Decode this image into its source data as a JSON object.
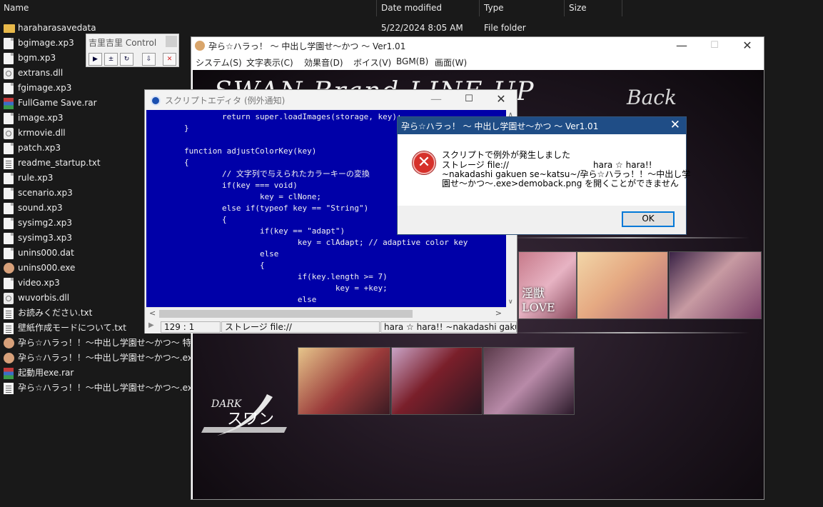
{
  "explorer": {
    "columns": {
      "name": "Name",
      "date": "Date modified",
      "type": "Type",
      "size": "Size"
    },
    "rows": [
      {
        "name": "haraharasavedata",
        "date": "5/22/2024 8:05 AM",
        "type": "File folder",
        "icon": "folder-icon"
      },
      {
        "name": "bgimage.xp3",
        "icon": "file-icon"
      },
      {
        "name": "bgm.xp3",
        "icon": "file-icon"
      },
      {
        "name": "extrans.dll",
        "icon": "dll-icon"
      },
      {
        "name": "fgimage.xp3",
        "icon": "file-icon"
      },
      {
        "name": "FullGame Save.rar",
        "icon": "rar-icon"
      },
      {
        "name": "image.xp3",
        "icon": "file-icon"
      },
      {
        "name": "krmovie.dll",
        "icon": "dll-icon"
      },
      {
        "name": "patch.xp3",
        "icon": "file-icon"
      },
      {
        "name": "readme_startup.txt",
        "icon": "text-file-icon"
      },
      {
        "name": "rule.xp3",
        "icon": "file-icon"
      },
      {
        "name": "scenario.xp3",
        "icon": "file-icon"
      },
      {
        "name": "sound.xp3",
        "icon": "file-icon"
      },
      {
        "name": "sysimg2.xp3",
        "icon": "file-icon"
      },
      {
        "name": "sysimg3.xp3",
        "icon": "file-icon"
      },
      {
        "name": "unins000.dat",
        "icon": "file-icon"
      },
      {
        "name": "unins000.exe",
        "icon": "exe-icon"
      },
      {
        "name": "video.xp3",
        "icon": "file-icon"
      },
      {
        "name": "wuvorbis.dll",
        "icon": "dll-icon"
      },
      {
        "name": "お読みください.txt",
        "icon": "text-file-icon"
      },
      {
        "name": "壁紙作成モードについて.txt",
        "icon": "text-file-icon"
      },
      {
        "name": "孕ら☆ハラっ！！～中出し学園せ～かつ～ 特別",
        "icon": "exe-icon"
      },
      {
        "name": "孕ら☆ハラっ！！～中出し学園せ～かつ～.exe",
        "icon": "exe-icon"
      },
      {
        "name": "起動用exe.rar",
        "icon": "rar-icon"
      },
      {
        "name": "孕ら☆ハラっ！！～中出し学園せ～かつ～.exe.",
        "icon": "text-file-icon"
      }
    ]
  },
  "palette": {
    "title": "吉里吉里 Control",
    "buttons": [
      {
        "label": "▶",
        "icon": "play-icon"
      },
      {
        "label": "±",
        "icon": "step-icon"
      },
      {
        "label": "↻",
        "icon": "refresh-icon"
      },
      {
        "label": "⇩",
        "icon": "arrow-down-icon"
      },
      {
        "label": "✕",
        "icon": "stop-icon"
      }
    ]
  },
  "game_window": {
    "title": "孕ら☆ハラっ！ ～ 中出し学園せ～かつ ～ Ver1.01",
    "controls": {
      "minimize": "—",
      "maximize": "☐",
      "close": "✕"
    },
    "menu": [
      "システム(S)",
      "文字表示(C)",
      "効果音(D)",
      "ボイス(V)",
      "BGM(B)",
      "画面(W)"
    ],
    "heading": "SWAN Brand LINE UP",
    "back_label": "Back",
    "thumb_captions": [
      "淫獣LOVE",
      "",
      ""
    ],
    "dark_logo_text": "DARK スワン"
  },
  "editor": {
    "title": "スクリプトエディタ (例外通知)",
    "code_lines": [
      "                return super.loadImages(storage, key);",
      "        }",
      "",
      "        function adjustColorKey(key)",
      "        {",
      "                // 文字列で与えられたカラーキーの変換",
      "                if(key === void)",
      "                        key = clNone;",
      "                else if(typeof key == \"String\")",
      "                {",
      "                        if(key == \"adapt\")",
      "                                key = clAdapt; // adaptive color key",
      "                        else",
      "                        {",
      "                                if(key.length >= 7)",
      "                                        key = +key;",
      "                                else"
    ],
    "status": {
      "arrow": "▶",
      "position": "129 : 1",
      "storage": "ストレージ file://",
      "file": "hara ☆ hara!! ~nakadashi gakuen"
    }
  },
  "dialog": {
    "title": "孕ら☆ハラっ！ ～ 中出し学園せ～かつ ～ Ver1.01",
    "line1": "スクリプトで例外が発生しました",
    "line2a": "ストレージ file://",
    "line2b": "hara ☆ hara!!",
    "line3": "~nakadashi gakuen se~katsu~/孕ら☆ハラっ！！～中出し学",
    "line4": "園せ～かつ～.exe>demoback.png を開くことができません",
    "ok_label": "OK"
  },
  "colors": {
    "editor_bg": "#0000a8",
    "dialog_titlebar": "#1f4d86",
    "error_red": "#d6302a"
  }
}
